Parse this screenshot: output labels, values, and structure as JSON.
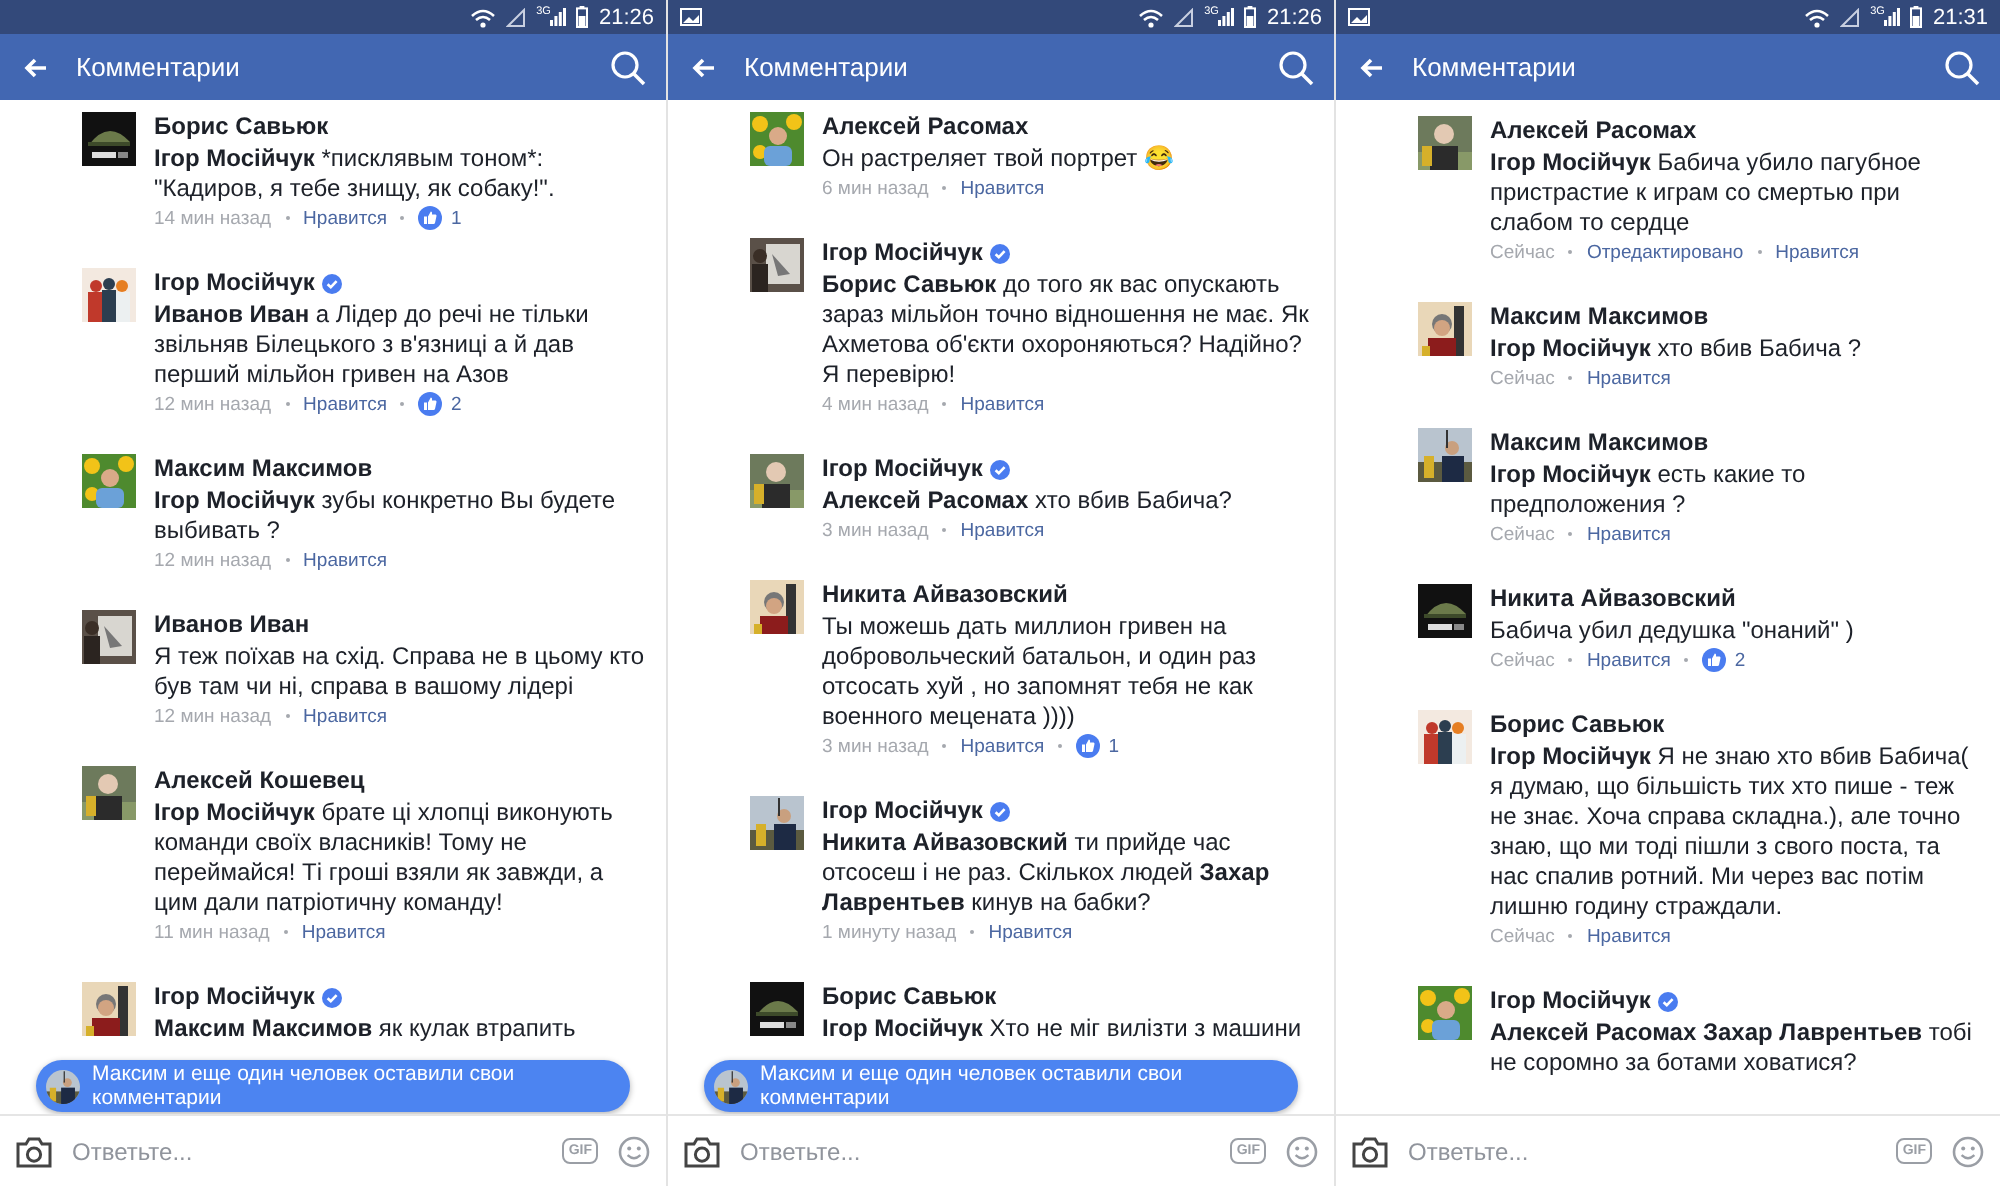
{
  "panels": [
    {
      "status_bar": {
        "notification_icon": false,
        "network": "3G",
        "time": "21:26"
      },
      "app_bar": {
        "title": "Комментарии"
      },
      "comments": [
        {
          "author": "Борис Савьюк",
          "verified": false,
          "text": [
            {
              "bold": true,
              "t": "Ігор Мосійчук"
            },
            {
              "bold": false,
              "t": " *писклявым тоном*: \"Кадиров, я тебе знищу, як собаку!\"."
            }
          ],
          "time": "14 мин назад",
          "like": "Нравится",
          "likes": "1"
        },
        {
          "author": "Ігор Мосійчук",
          "verified": true,
          "text": [
            {
              "bold": true,
              "t": "Иванов Иван"
            },
            {
              "bold": false,
              "t": " а Лідер до речі не тільки звільняв Білецького з в'язниці а й дав перший мільйон гривен на Азов"
            }
          ],
          "time": "12 мин назад",
          "like": "Нравится",
          "likes": "2"
        },
        {
          "author": "Максим Максимов",
          "verified": false,
          "text": [
            {
              "bold": true,
              "t": "Ігор Мосійчук"
            },
            {
              "bold": false,
              "t": " зубы конкретно Вы будете выбивать ?"
            }
          ],
          "time": "12 мин назад",
          "like": "Нравится"
        },
        {
          "author": "Иванов Иван",
          "verified": false,
          "text": [
            {
              "bold": false,
              "t": "Я теж поїхав на схід. Справа не в цьому кто був там чи ні, справа в вашому лідері"
            }
          ],
          "time": "12 мин назад",
          "like": "Нравится"
        },
        {
          "author": "Алексей Кошевец",
          "verified": false,
          "text": [
            {
              "bold": true,
              "t": "Ігор Мосійчук"
            },
            {
              "bold": false,
              "t": " брате ці хлопці виконують команди своїх власників! Тому не переймайся! Ті гроші взяли як завжди, а цим дали патріотичну команду!"
            }
          ],
          "time": "11 мин назад",
          "like": "Нравится"
        },
        {
          "author": "Ігор Мосійчук",
          "verified": true,
          "text": [
            {
              "bold": true,
              "t": "Максим Максимов"
            },
            {
              "bold": false,
              "t": " як кулак втрапить"
            }
          ]
        }
      ],
      "toast": {
        "text": "Максим и еще один человек оставили свои комментарии"
      },
      "reply_bar": {
        "placeholder": "Ответьте...",
        "gif_label": "GIF"
      }
    },
    {
      "status_bar": {
        "notification_icon": true,
        "network": "3G",
        "time": "21:26"
      },
      "app_bar": {
        "title": "Комментарии"
      },
      "comments": [
        {
          "author": "Алексей Расомах",
          "verified": false,
          "text": [
            {
              "bold": false,
              "t": "Он растреляет твой портрет 😂"
            }
          ],
          "time": "6 мин назад",
          "like": "Нравится"
        },
        {
          "author": "Ігор Мосійчук",
          "verified": true,
          "text": [
            {
              "bold": true,
              "t": "Борис Савьюк"
            },
            {
              "bold": false,
              "t": " до того як вас опускають зараз мільйон точно відношення не має. Як Ахметова об'єкти охороняються? Надійно? Я перевірю!"
            }
          ],
          "time": "4 мин назад",
          "like": "Нравится"
        },
        {
          "author": "Ігор Мосійчук",
          "verified": true,
          "text": [
            {
              "bold": true,
              "t": "Алексей Расомах"
            },
            {
              "bold": false,
              "t": " хто вбив Бабича?"
            }
          ],
          "time": "3 мин назад",
          "like": "Нравится"
        },
        {
          "author": "Никита Айвазовский",
          "verified": false,
          "text": [
            {
              "bold": false,
              "t": "Ты можешь дать миллион гривен на добровольческий батальон, и один раз отсосать хуй , но запомнят тебя не как военного мецената ))))"
            }
          ],
          "time": "3 мин назад",
          "like": "Нравится",
          "likes": "1"
        },
        {
          "author": "Ігор Мосійчук",
          "verified": true,
          "text": [
            {
              "bold": true,
              "t": "Никита Айвазовский"
            },
            {
              "bold": false,
              "t": " ти прийде час отсосеш і не раз. Скількох людей "
            },
            {
              "bold": true,
              "t": "Захар Лаврентьев"
            },
            {
              "bold": false,
              "t": " кинув на бабки?"
            }
          ],
          "time": "1 минуту назад",
          "like": "Нравится"
        },
        {
          "author": "Борис Савьюк",
          "verified": false,
          "text": [
            {
              "bold": true,
              "t": "Ігор Мосійчук"
            },
            {
              "bold": false,
              "t": " Хто не міг вилізти з машини"
            }
          ]
        }
      ],
      "toast": {
        "text": "Максим и еще один человек оставили свои комментарии"
      },
      "reply_bar": {
        "placeholder": "Ответьте...",
        "gif_label": "GIF"
      }
    },
    {
      "status_bar": {
        "notification_icon": true,
        "network": "3G",
        "time": "21:31"
      },
      "app_bar": {
        "title": "Комментарии"
      },
      "comments": [
        {
          "author": "Алексей Расомах",
          "verified": false,
          "text": [
            {
              "bold": true,
              "t": "Ігор Мосійчук"
            },
            {
              "bold": false,
              "t": " Бабича убило пагубное пристрастие к играм со смертью при слабом то сердце"
            }
          ],
          "time": "Сейчас",
          "edited": "Отредактировано",
          "like": "Нравится"
        },
        {
          "author": "Максим Максимов",
          "verified": false,
          "text": [
            {
              "bold": true,
              "t": "Ігор Мосійчук"
            },
            {
              "bold": false,
              "t": " хто вбив Бабича ?"
            }
          ],
          "time": "Сейчас",
          "like": "Нравится"
        },
        {
          "author": "Максим Максимов",
          "verified": false,
          "text": [
            {
              "bold": true,
              "t": "Ігор Мосійчук"
            },
            {
              "bold": false,
              "t": " есть какие то предположения ?"
            }
          ],
          "time": "Сейчас",
          "like": "Нравится"
        },
        {
          "author": "Никита Айвазовский",
          "verified": false,
          "text": [
            {
              "bold": false,
              "t": "Бабича убил дедушка \"онаний\" )"
            }
          ],
          "time": "Сейчас",
          "like": "Нравится",
          "likes": "2"
        },
        {
          "author": "Борис Савьюк",
          "verified": false,
          "text": [
            {
              "bold": true,
              "t": "Ігор Мосійчук"
            },
            {
              "bold": false,
              "t": " Я не знаю хто вбив Бабича( я думаю, що більшість тих хто пише - теж не знає. Хоча справа складна.), але точно знаю, що ми тоді пішли з свого поста, та нас спалив ротний. Ми через вас потім лишню годину страждали."
            }
          ],
          "time": "Сейчас",
          "like": "Нравится"
        },
        {
          "author": "Ігор Мосійчук",
          "verified": true,
          "text": [
            {
              "bold": true,
              "t": "Алексей Расомах Захар Лаврентьев"
            },
            {
              "bold": false,
              "t": " тобі не соромно за ботами ховатися?"
            }
          ]
        }
      ],
      "reply_bar": {
        "placeholder": "Ответьте...",
        "gif_label": "GIF"
      }
    }
  ]
}
